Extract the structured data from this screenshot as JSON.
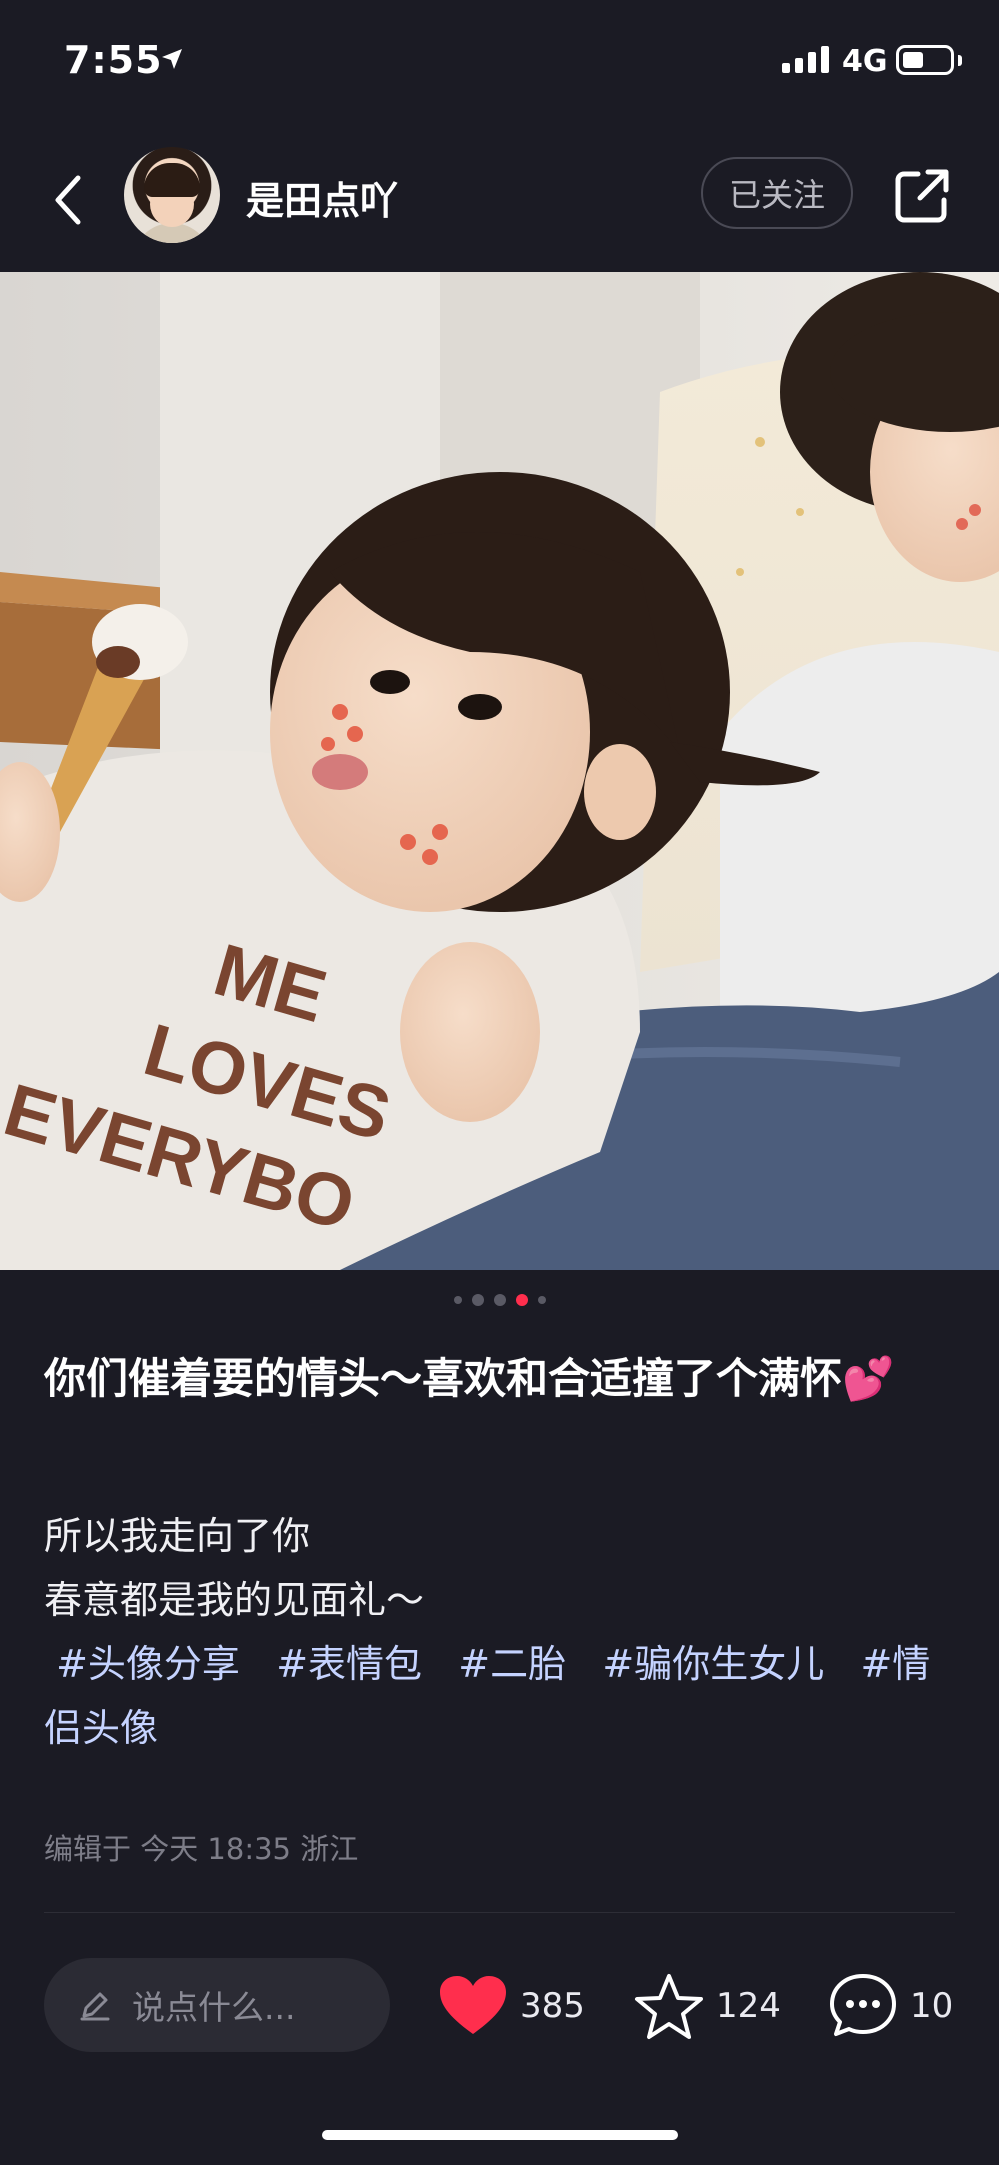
{
  "status_bar": {
    "time": "7:55",
    "network": "4G",
    "battery_level_percent": 40
  },
  "nav": {
    "username": "是田点吖",
    "follow_label": "已关注",
    "icons": {
      "back": "chevron-left-icon",
      "share": "share-icon"
    }
  },
  "carousel": {
    "page_count": 5,
    "active_index": 3
  },
  "post": {
    "title": "你们催着要的情头～喜欢和合适撞了个满怀💕",
    "body_lines": [
      "所以我走向了你",
      "春意都是我的见面礼～"
    ],
    "tags": [
      "#头像分享",
      "#表情包",
      "#二胎",
      "#骗你生女儿",
      "#情侣头像"
    ],
    "meta": "编辑于 今天 18:35 浙江"
  },
  "bottom_bar": {
    "comment_placeholder": "说点什么...",
    "likes": "385",
    "favorites": "124",
    "comments": "10",
    "like_color": "#ff2e4d"
  }
}
